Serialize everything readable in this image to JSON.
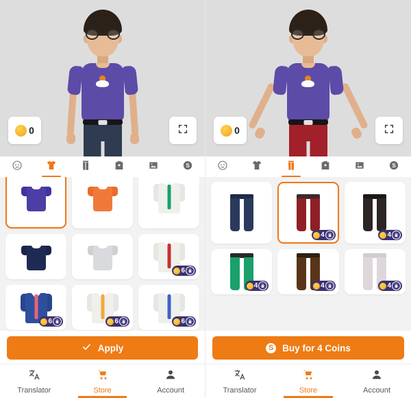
{
  "app": {
    "accent_color": "#ef7b14",
    "stage_bg": "#dddddd",
    "grid_bg": "#f2f2f2",
    "badge_bg": "#3b3272"
  },
  "panels": [
    {
      "id": "left",
      "coin_balance": "0",
      "avatar": {
        "pose": "arms-down",
        "shirt_color": "#5d4ba8",
        "pants_color": "#2e3b50",
        "hair_color": "#2b2119",
        "skin_color": "#e8bb97"
      },
      "category_tabs": [
        {
          "name": "tab-face",
          "icon": "face-icon",
          "active": false
        },
        {
          "name": "tab-tops",
          "icon": "tshirt-icon",
          "active": true
        },
        {
          "name": "tab-pants",
          "icon": "pants-icon",
          "active": false
        },
        {
          "name": "tab-bag",
          "icon": "bag-star-icon",
          "active": false
        },
        {
          "name": "tab-background",
          "icon": "image-icon",
          "active": false
        },
        {
          "name": "tab-coins",
          "icon": "dollar-icon",
          "active": false
        }
      ],
      "items": [
        {
          "name": "item-purple-tshirt",
          "kind": "tshirt",
          "body": "#4b3fa5",
          "sleeve": "#4133a0",
          "selected": true,
          "price": null,
          "locked": false
        },
        {
          "name": "item-orange-tshirt",
          "kind": "tshirt",
          "body": "#f0793a",
          "sleeve": "#e86c2c",
          "selected": false,
          "price": null,
          "locked": false
        },
        {
          "name": "item-green-tie-coat",
          "kind": "coat",
          "body": "#efefec",
          "sleeve": "#e6e6e2",
          "tie": "#17a06c",
          "selected": false,
          "price": null,
          "locked": false
        },
        {
          "name": "item-navy-jersey",
          "kind": "tshirt",
          "body": "#1f2a54",
          "sleeve": "#1b2448",
          "selected": false,
          "price": null,
          "locked": false
        },
        {
          "name": "item-white-jersey",
          "kind": "tshirt",
          "body": "#d9dadd",
          "sleeve": "#cfd0d4",
          "selected": false,
          "price": null,
          "locked": false
        },
        {
          "name": "item-red-tie-coat",
          "kind": "coat",
          "body": "#efefec",
          "sleeve": "#e6e6e2",
          "tie": "#c2322c",
          "selected": false,
          "price": "6",
          "locked": true
        },
        {
          "name": "item-blue-suit",
          "kind": "coat",
          "body": "#2e4f9e",
          "sleeve": "#27468d",
          "tie": "#ec6276",
          "selected": false,
          "price": "6",
          "locked": true
        },
        {
          "name": "item-orange-tie-coat",
          "kind": "coat",
          "body": "#efefec",
          "sleeve": "#e6e6e2",
          "tie": "#f0a93c",
          "selected": false,
          "price": "6",
          "locked": true
        },
        {
          "name": "item-blue-tie-coat",
          "kind": "coat",
          "body": "#efefec",
          "sleeve": "#e6e6e2",
          "tie": "#3f63c4",
          "selected": false,
          "price": "6",
          "locked": true
        }
      ],
      "action": {
        "label": "Apply",
        "icon": "check-icon",
        "show_dollar": false
      }
    },
    {
      "id": "right",
      "coin_balance": "0",
      "avatar": {
        "pose": "arms-spread",
        "shirt_color": "#5d4ba8",
        "pants_color": "#a2202a",
        "hair_color": "#2b2119",
        "skin_color": "#e8bb97"
      },
      "category_tabs": [
        {
          "name": "tab-face",
          "icon": "face-icon",
          "active": false
        },
        {
          "name": "tab-tops",
          "icon": "tshirt-icon",
          "active": false
        },
        {
          "name": "tab-pants",
          "icon": "pants-icon",
          "active": true
        },
        {
          "name": "tab-bag",
          "icon": "bag-star-icon",
          "active": false
        },
        {
          "name": "tab-background",
          "icon": "image-icon",
          "active": false
        },
        {
          "name": "tab-coins",
          "icon": "dollar-icon",
          "active": false
        }
      ],
      "items": [
        {
          "name": "item-navy-jeans",
          "kind": "jeans",
          "leg": "#2a3a5c",
          "waist": "#1f2c47",
          "selected": false,
          "price": null,
          "locked": false
        },
        {
          "name": "item-red-jeans",
          "kind": "jeans",
          "leg": "#8f1f26",
          "waist": "#3b2a2c",
          "selected": true,
          "price": "4",
          "locked": true
        },
        {
          "name": "item-black-jeans",
          "kind": "jeans",
          "leg": "#2c2523",
          "waist": "#1d1917",
          "selected": false,
          "price": "4",
          "locked": true
        },
        {
          "name": "item-green-jeans",
          "kind": "jeans",
          "leg": "#1aa06a",
          "waist": "#2b2a2a",
          "selected": false,
          "price": "4",
          "locked": true
        },
        {
          "name": "item-brown-jeans",
          "kind": "jeans",
          "leg": "#5a3418",
          "waist": "#2e2013",
          "selected": false,
          "price": "4",
          "locked": true
        },
        {
          "name": "item-white-jeans",
          "kind": "jeans",
          "leg": "#ddd7dc",
          "waist": "#d2ccd1",
          "selected": false,
          "price": "4",
          "locked": true
        }
      ],
      "action": {
        "label": "Buy for 4 Coins",
        "icon": "dollar-icon",
        "show_dollar": true
      }
    }
  ],
  "bottom_nav": [
    {
      "name": "nav-translator",
      "label": "Translator",
      "icon": "translate-icon",
      "active": false
    },
    {
      "name": "nav-store",
      "label": "Store",
      "icon": "cart-icon",
      "active": true
    },
    {
      "name": "nav-account",
      "label": "Account",
      "icon": "person-icon",
      "active": false
    }
  ]
}
